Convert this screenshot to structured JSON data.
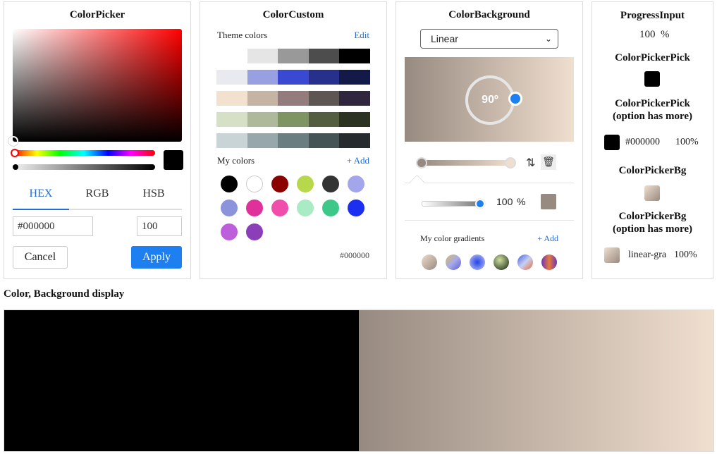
{
  "colorPicker": {
    "title": "ColorPicker",
    "tabs": [
      "HEX",
      "RGB",
      "HSB"
    ],
    "hex_value": "#000000",
    "alpha_value": "100",
    "cancel_label": "Cancel",
    "apply_label": "Apply",
    "hue_color": "#ff0000",
    "selected_color": "#000000"
  },
  "colorCustom": {
    "title": "ColorCustom",
    "theme_label": "Theme colors",
    "edit_label": "Edit",
    "theme_rows": [
      [
        "#ffffff",
        "#e5e5e5",
        "#999999",
        "#4d4d4d",
        "#000000"
      ],
      [
        "#e8eaf0",
        "#98a0e2",
        "#3a49d1",
        "#27308c",
        "#141a48"
      ],
      [
        "#f3e1d0",
        "#c5b3a4",
        "#947c7c",
        "#5e5653",
        "#30263e"
      ],
      [
        "#d6e0c7",
        "#aeb99c",
        "#7f9463",
        "#535e41",
        "#2c3222"
      ],
      [
        "#c9d4d6",
        "#98a7ab",
        "#6a7d80",
        "#465356",
        "#262b2d"
      ]
    ],
    "my_colors_label": "My colors",
    "add_label": "+ Add",
    "my_colors": [
      "#000000",
      "#ffffff",
      "#8b0000",
      "#b7d84a",
      "#333333",
      "#a3a6ea",
      "#8c93dd",
      "#e0319a",
      "#ef4fab",
      "#a8ebc4",
      "#3dc88a",
      "#1c2ef0",
      "#bd5fdd",
      "#8a3fb8"
    ],
    "current_hex": "#000000"
  },
  "colorBackground": {
    "title": "ColorBackground",
    "mode": "Linear",
    "angle": "90º",
    "gradient_start": "#978a80",
    "gradient_end": "#f0dfcf",
    "opacity_value": "100",
    "opacity_unit": "%",
    "stop_color": "#978a80",
    "my_gradients_label": "My color gradients",
    "add_label": "+ Add",
    "gradients": [
      "linear-gradient(135deg, #efdccc, #978a80)",
      "linear-gradient(135deg, #d4c05c, #a7a9ea 50%, #5d5fd3)",
      "radial-gradient(circle, #2343e8, #c4c8f2)",
      "radial-gradient(circle at 40% 35%, #cfe0a0, #4b5a3a 70%, #1b2440)",
      "linear-gradient(135deg, #3c5fe0, #c8d0f0 50%, #e86a3a)",
      "linear-gradient(90deg, #6f35b8, #e67a3a 50%, #6f35b8)"
    ]
  },
  "right": {
    "progress_title": "ProgressInput",
    "progress_value": "100",
    "progress_unit": "%",
    "pick_title": "ColorPickerPick",
    "pick_more_title_1": "ColorPickerPick",
    "pick_more_title_2": "(option has more)",
    "pick_hex": "#000000",
    "pick_percent": "100%",
    "bg_title": "ColorPickerBg",
    "bg_more_title_1": "ColorPickerBg",
    "bg_more_title_2": "(option has more)",
    "bg_text": "linear-gra",
    "bg_percent": "100%"
  },
  "display": {
    "title": "Color, Background display",
    "left_color": "#000000",
    "right_gradient_start": "#978a80",
    "right_gradient_end": "#f0dfcf"
  }
}
